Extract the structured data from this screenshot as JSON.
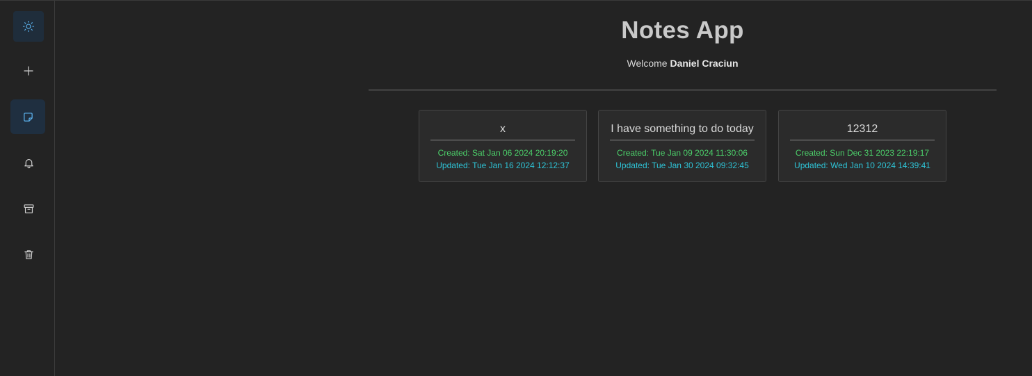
{
  "app": {
    "title": "Notes App",
    "welcome_prefix": "Welcome",
    "user_name": "Daniel Craciun"
  },
  "sidebar": {
    "items": [
      {
        "icon": "sun-icon",
        "label": "theme-toggle"
      },
      {
        "icon": "plus-icon",
        "label": "add-note"
      },
      {
        "icon": "sticky-note-icon",
        "label": "notes",
        "active": true
      },
      {
        "icon": "bell-icon",
        "label": "reminders"
      },
      {
        "icon": "archive-icon",
        "label": "archive"
      },
      {
        "icon": "trash-icon",
        "label": "trash"
      }
    ]
  },
  "notes": [
    {
      "title": "x",
      "created": "Created: Sat Jan 06 2024 20:19:20",
      "updated": "Updated: Tue Jan 16 2024 12:12:37"
    },
    {
      "title": "I have something to do today",
      "created": "Created: Tue Jan 09 2024 11:30:06",
      "updated": "Updated: Tue Jan 30 2024 09:32:45"
    },
    {
      "title": "12312",
      "created": "Created: Sun Dec 31 2023 22:19:17",
      "updated": "Updated: Wed Jan 10 2024 14:39:41"
    }
  ],
  "colors": {
    "background": "#232323",
    "created_text": "#4ccf6a",
    "updated_text": "#2ec3d6",
    "active_nav": "#1f2f40",
    "accent_icon": "#5aaee8"
  }
}
